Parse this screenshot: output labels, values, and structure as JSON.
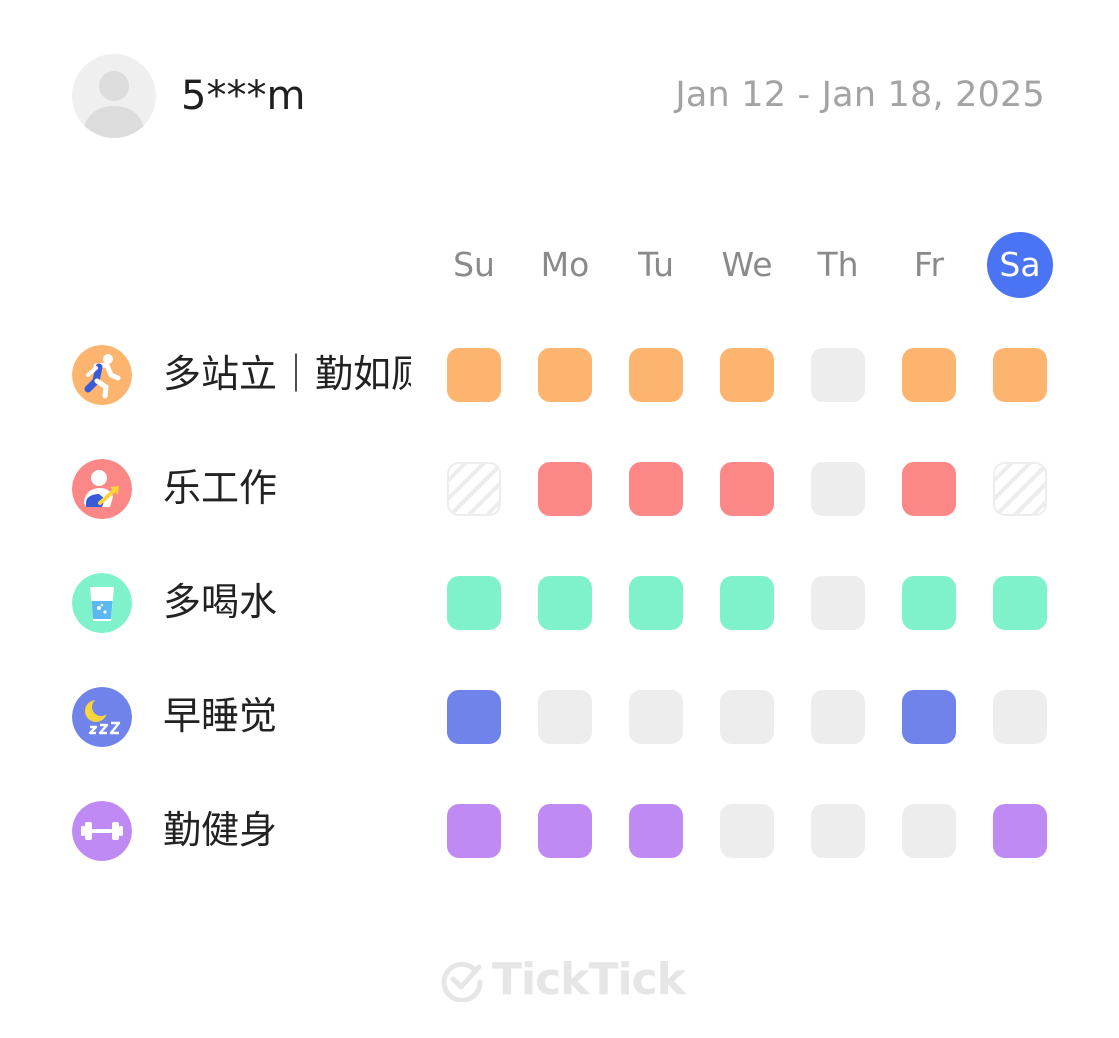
{
  "header": {
    "username": "5***m",
    "date_range": "Jan 12 - Jan 18, 2025"
  },
  "days": [
    "Su",
    "Mo",
    "Tu",
    "We",
    "Th",
    "Fr",
    "Sa"
  ],
  "today": "Sa",
  "habits": [
    {
      "name": "多站立｜勤如厕",
      "icon": "running-person-icon",
      "icon_bg": "#FDB46E",
      "color": "#FDB46E",
      "days": [
        "done",
        "done",
        "done",
        "done",
        "none",
        "done",
        "done"
      ]
    },
    {
      "name": "乐工作",
      "icon": "worker-growth-icon",
      "icon_bg": "#FB8786",
      "color": "#FB8786",
      "days": [
        "skipped",
        "done",
        "done",
        "done",
        "none",
        "done",
        "skipped"
      ]
    },
    {
      "name": "多喝水",
      "icon": "water-glass-icon",
      "icon_bg": "#80F2CB",
      "color": "#80F2CB",
      "days": [
        "done",
        "done",
        "done",
        "done",
        "none",
        "done",
        "done"
      ]
    },
    {
      "name": "早睡觉",
      "icon": "moon-sleep-icon",
      "icon_bg": "#6F83EA",
      "color": "#6F83EA",
      "days": [
        "done",
        "none",
        "none",
        "none",
        "none",
        "done",
        "none"
      ]
    },
    {
      "name": "勤健身",
      "icon": "dumbbell-icon",
      "icon_bg": "#C08AF4",
      "color": "#C08AF4",
      "days": [
        "done",
        "done",
        "done",
        "none",
        "none",
        "none",
        "done"
      ]
    }
  ],
  "colors": {
    "empty_cell": "#EDEDED",
    "today_bg": "#4A74F3"
  },
  "footer": {
    "brand": "TickTick"
  }
}
